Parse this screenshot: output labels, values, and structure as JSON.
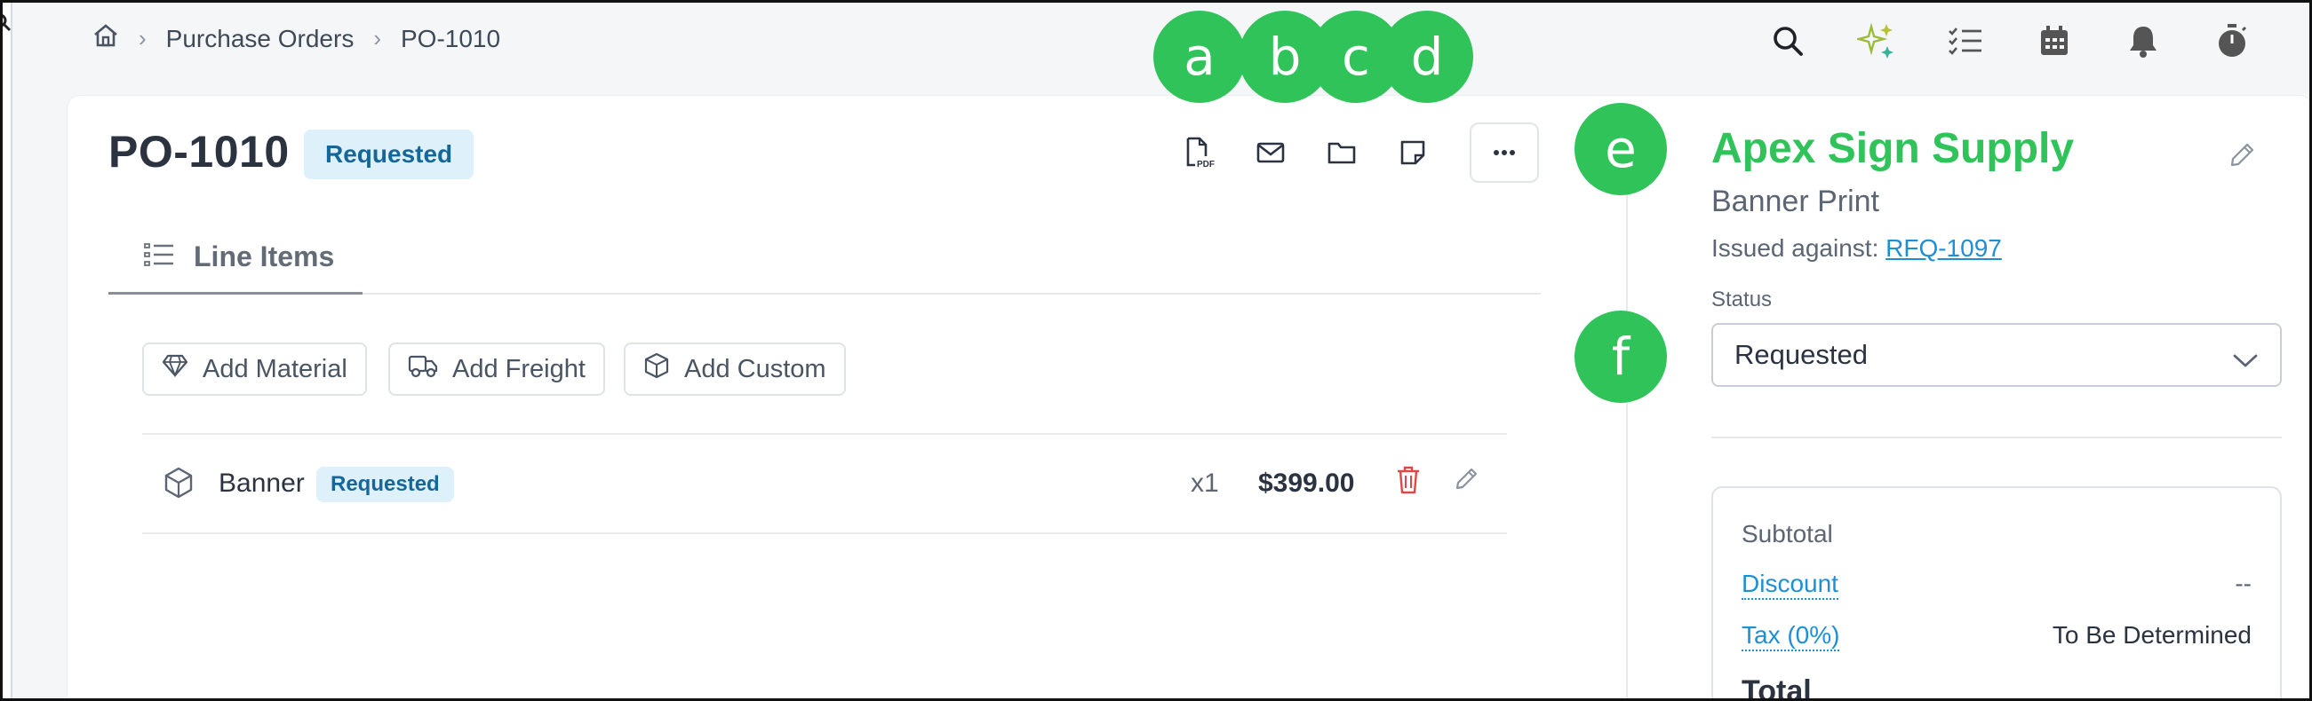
{
  "breadcrumb": {
    "home_icon": "home-icon",
    "items": [
      "Purchase Orders",
      "PO-1010"
    ]
  },
  "topbar": {
    "icons": [
      "search-icon",
      "sparkle-icon",
      "checklist-icon",
      "calendar-icon",
      "bell-icon",
      "timer-icon"
    ]
  },
  "order": {
    "id": "PO-1010",
    "status_badge": "Requested",
    "actions": [
      "pdf-icon",
      "email-icon",
      "folder-icon",
      "note-icon",
      "more-icon"
    ]
  },
  "tabs": [
    {
      "label": "Line Items",
      "icon": "list-icon"
    }
  ],
  "add_buttons": [
    {
      "label": "Add Material",
      "icon": "gem-icon"
    },
    {
      "label": "Add Freight",
      "icon": "truck-icon"
    },
    {
      "label": "Add Custom",
      "icon": "cube-icon"
    }
  ],
  "line_items": [
    {
      "name": "Banner",
      "status": "Requested",
      "qty": "x1",
      "price": "$399.00"
    }
  ],
  "vendor": {
    "name": "Apex Sign Supply",
    "subject": "Banner Print",
    "issued_label": "Issued against:",
    "issued_link": "RFQ-1097"
  },
  "status_field": {
    "label": "Status",
    "value": "Requested"
  },
  "totals": {
    "subtotal_label": "Subtotal",
    "discount_label": "Discount",
    "discount_value": "--",
    "tax_label": "Tax (0%)",
    "tax_value": "To Be Determined",
    "total_label": "Total"
  },
  "markers": [
    "a",
    "b",
    "c",
    "d",
    "e",
    "f"
  ],
  "colors": {
    "accent_green": "#2fc35a",
    "badge_bg": "#def1fb",
    "badge_text": "#15679a",
    "link": "#1d8fd6",
    "danger": "#e04848"
  }
}
